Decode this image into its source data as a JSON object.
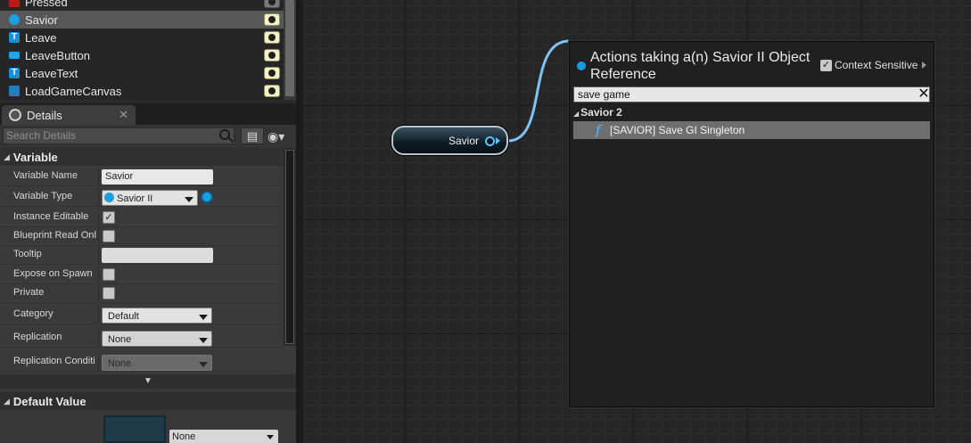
{
  "variables_list": {
    "items": [
      {
        "label": "Pressed",
        "icon": "red-event-icon",
        "selected": false
      },
      {
        "label": "Savior",
        "icon": "savior-object-icon",
        "selected": true
      },
      {
        "label": "Leave",
        "icon": "text-widget-icon",
        "selected": false
      },
      {
        "label": "LeaveButton",
        "icon": "button-widget-icon",
        "selected": false
      },
      {
        "label": "LeaveText",
        "icon": "text-widget-icon",
        "selected": false
      },
      {
        "label": "LoadGameCanvas",
        "icon": "canvas-widget-icon",
        "selected": false
      }
    ]
  },
  "details": {
    "tab_label": "Details",
    "search_placeholder": "Search Details",
    "grid_button_glyph": "▤",
    "eye_button_glyph": "◉▾",
    "variable_section": "Variable",
    "rows": {
      "variable_name_label": "Variable Name",
      "variable_name_value": "Savior",
      "variable_type_label": "Variable Type",
      "variable_type_value": "Savior II",
      "instance_editable_label": "Instance Editable",
      "instance_editable_checked": true,
      "blueprint_read_only_label": "Blueprint Read Onl",
      "tooltip_label": "Tooltip",
      "tooltip_value": "",
      "expose_on_spawn_label": "Expose on Spawn",
      "private_label": "Private",
      "category_label": "Category",
      "category_value": "Default",
      "replication_label": "Replication",
      "replication_value": "None",
      "replication_condition_label": "Replication Conditi",
      "replication_condition_value": "None"
    },
    "default_value_section": "Default Value",
    "default_value_select": "None"
  },
  "graph": {
    "node_label": "Savior",
    "wire_color": "#7ec3f5",
    "pin_color": "#5cc1ff"
  },
  "action_menu": {
    "title": "Actions taking a(n) Savior II Object Reference",
    "context_sensitive_label": "Context Sensitive",
    "context_sensitive_checked": true,
    "search_value": "save game",
    "category": "Savior 2",
    "result_icon": "function-icon",
    "result_label": "[SAVIOR] Save GI Singleton"
  }
}
